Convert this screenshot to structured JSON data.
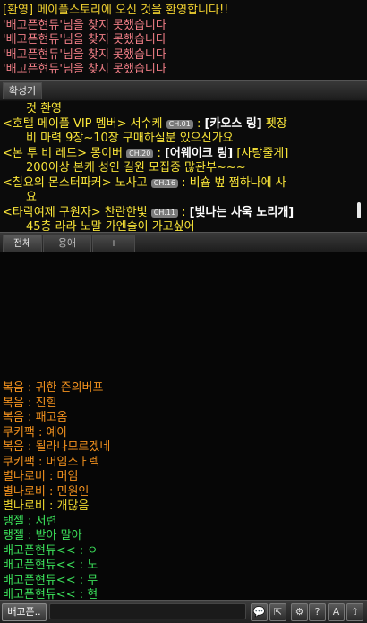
{
  "system_log": {
    "welcome": "[환영] 메이플스토리에 오신 것을 환영합니다!!",
    "not_found_lines": [
      "'배고픈현듀'님을 찾지 못했습니다",
      "'배고픈현듀'님을 찾지 못했습니다",
      "'배고픈현듀'님을 찾지 못했습니다",
      "'배고픈현듀'님을 찾지 못했습니다"
    ]
  },
  "megaphone_tab": {
    "label": "확성기"
  },
  "megaphone": {
    "partial_line": "것 환영",
    "messages": [
      {
        "prefix": "<호텔 메이플 VIP 멤버> 서수케",
        "channel": "CH.01",
        "sep": " : ",
        "item": "[카오스 링]",
        "text": "  펫장",
        "cont": "비 마력 9장~10장 구매하실분 있으신가요"
      },
      {
        "prefix": "<본 투 비 레드> 몽이버",
        "channel": "CH.20",
        "sep": " : ",
        "item": "[어웨이크 링]",
        "text": "  [사탕줄게]",
        "cont": "200이상 본캐 성인 길원 모집중 많관부~~~"
      },
      {
        "prefix": "<칠요의 몬스터파커> 노사고",
        "channel": "CH.16",
        "sep": " :  ",
        "item": "",
        "text": "비숍 벞 쩜하나에 사",
        "cont": "요"
      },
      {
        "prefix": "<타락여제 구원자> 찬란한빛",
        "channel": "CH.11",
        "sep": " : ",
        "item": "[빛나는 사욱 노리개]",
        "text": "",
        "cont": "45층 라라 노말 가엔슬이 가고싶어"
      }
    ]
  },
  "chat_tabs": [
    {
      "label": "전체"
    },
    {
      "label": "용애"
    },
    {
      "label": "+"
    }
  ],
  "chat_messages": [
    {
      "name": "복음",
      "text": "귀한 즌의버프",
      "color": "orange"
    },
    {
      "name": "복음",
      "text": "진힐",
      "color": "orange"
    },
    {
      "name": "복음",
      "text": "패고옴",
      "color": "orange"
    },
    {
      "name": "쿠키팩",
      "text": "예아",
      "color": "orange"
    },
    {
      "name": "복음",
      "text": "될라나모르겠네",
      "color": "orange"
    },
    {
      "name": "쿠키팩",
      "text": "머임스ㅏ렉",
      "color": "orange"
    },
    {
      "name": "별나로비",
      "text": "머임",
      "color": "orange"
    },
    {
      "name": "별나로비",
      "text": "민원인",
      "color": "orange"
    },
    {
      "name": "별나로비",
      "text": "개많음",
      "color": "yellow"
    },
    {
      "name": "탱젤",
      "text": "저련",
      "color": "green"
    },
    {
      "name": "탱젤",
      "text": "받아 말아",
      "color": "green"
    },
    {
      "name": "배고픈현듀<<",
      "text": "ㅇ",
      "color": "green"
    },
    {
      "name": "배고픈현듀<<",
      "text": "노",
      "color": "green"
    },
    {
      "name": "배고픈현듀<<",
      "text": "무",
      "color": "green"
    },
    {
      "name": "배고픈현듀<<",
      "text": "현",
      "color": "green"
    }
  ],
  "bottom_bar": {
    "target_label": "배고픈..",
    "input_value": "",
    "buttons": [
      {
        "icon": "speech-bubble-icon",
        "glyph": "💬"
      },
      {
        "icon": "popout-icon",
        "glyph": "⇱"
      },
      {
        "icon": "settings-icon",
        "glyph": "⚙"
      },
      {
        "icon": "help-icon",
        "glyph": "?"
      },
      {
        "icon": "font-size-icon",
        "glyph": "A"
      },
      {
        "icon": "expand-icon",
        "glyph": "⇧"
      }
    ]
  },
  "colors": {
    "welcome": "#f2d230",
    "not_found": "#f07e86",
    "megaphone": "#ffea3a",
    "orange": "#f2911e",
    "yellow": "#f1d930",
    "green": "#3be05a"
  }
}
